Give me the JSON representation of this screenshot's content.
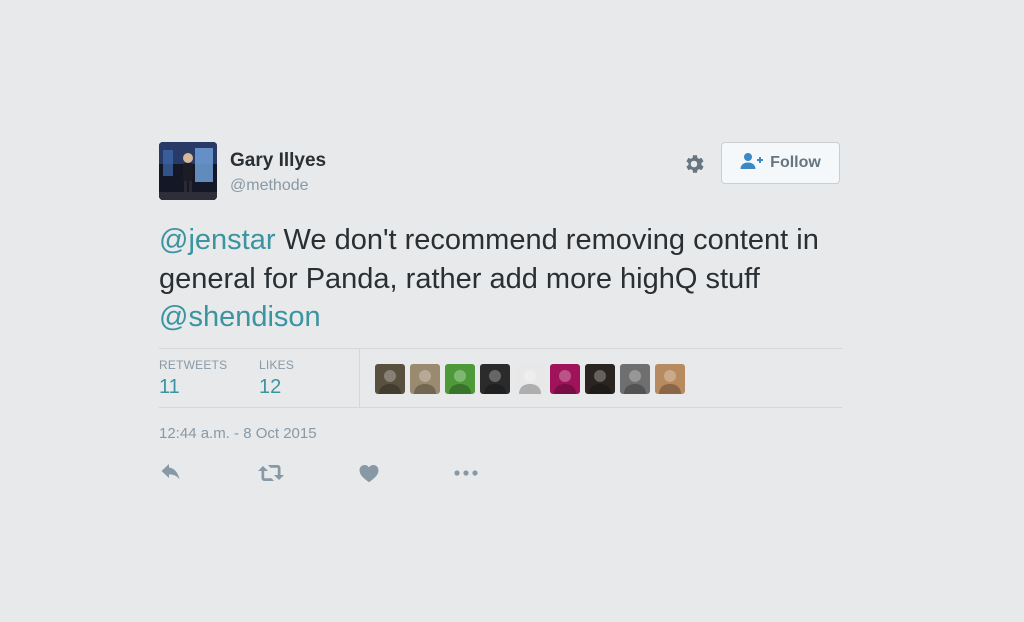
{
  "user": {
    "name": "Gary Illyes",
    "handle": "@methode"
  },
  "follow_button": {
    "label": "Follow"
  },
  "tweet": {
    "parts": [
      {
        "text": "@jenstar",
        "type": "mention"
      },
      {
        "text": " We don't recommend removing content in general for Panda, rather add more highQ stuff ",
        "type": "text"
      },
      {
        "text": "@shendison",
        "type": "mention"
      }
    ]
  },
  "stats": {
    "retweets_label": "RETWEETS",
    "retweets_count": "11",
    "likes_label": "LIKES",
    "likes_count": "12"
  },
  "timestamp": "12:44 a.m. - 8 Oct 2015",
  "likers": [
    {
      "color": "#5a5040"
    },
    {
      "color": "#9a8a70"
    },
    {
      "color": "#4e9a3a"
    },
    {
      "color": "#2b2b2b"
    },
    {
      "color": "#e8e8e8"
    },
    {
      "color": "#a0135a"
    },
    {
      "color": "#2a2420"
    },
    {
      "color": "#6f6f6f"
    },
    {
      "color": "#b88a60"
    }
  ],
  "icons": {
    "settings": "gear-icon",
    "follow": "person-plus-icon",
    "reply": "reply-icon",
    "retweet": "retweet-icon",
    "like": "heart-icon",
    "more": "more-icon"
  },
  "colors": {
    "accent": "#3b94a0",
    "muted": "#8899a6",
    "text": "#292f33",
    "background": "#e7e9eb"
  }
}
